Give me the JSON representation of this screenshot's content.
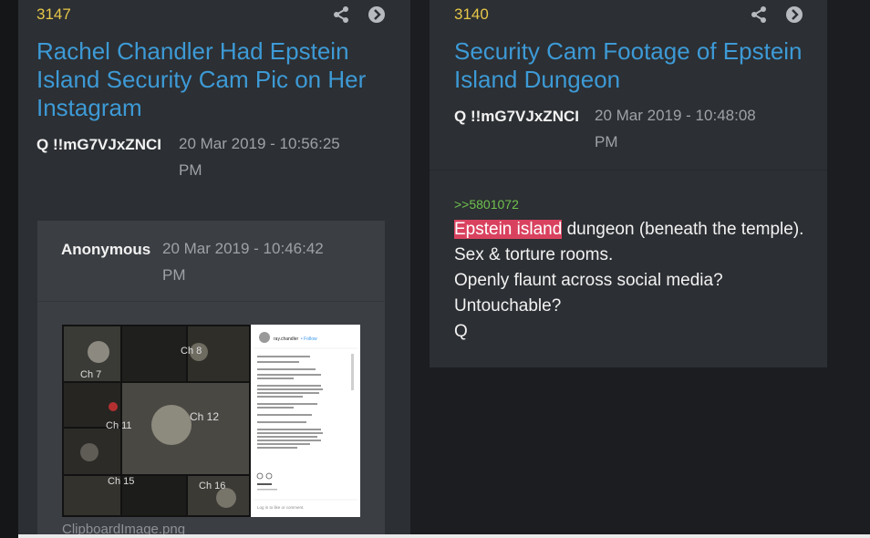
{
  "post_a": {
    "number": "3147",
    "title_lines": [
      "Rachel Chandler Had Epstein",
      "Island Security Cam Pic on Her",
      "Instagram"
    ],
    "author": "Q !!mG7VJxZNCI",
    "timestamp_lines": [
      "20 Mar 2019 - 10:56:25",
      "PM"
    ],
    "quoted": {
      "author": "Anonymous",
      "timestamp_lines": [
        "20 Mar 2019 - 10:46:42",
        "PM"
      ],
      "attachment_name": "ClipboardImage.png"
    }
  },
  "post_b": {
    "number": "3140",
    "title_lines": [
      "Security Cam Footage of Epstein",
      "Island Dungeon"
    ],
    "author": "Q !!mG7VJxZNCI",
    "timestamp_lines": [
      "20 Mar 2019 - 10:48:08",
      "PM"
    ],
    "reply_link": ">>5801072",
    "highlight": "Epstein island",
    "line1_rest": " dungeon (beneath the temple).",
    "lines": [
      "Sex & torture rooms.",
      "Openly flaunt across social media?",
      "Untouchable?",
      "Q"
    ]
  },
  "screenshot": {
    "cam_labels": [
      "Ch 8",
      "Ch 7",
      "Ch 12",
      "Ch 11",
      "Ch 15",
      "Ch 16"
    ],
    "insta_user": "ray.chandler",
    "insta_follow": "• Follow",
    "insta_link": "Log in to like or comment."
  },
  "icons": {
    "share": "share-icon",
    "goto": "arrow-right-circle-icon"
  },
  "colors": {
    "post_number": "#e6c74a",
    "title": "#3d9ad6",
    "reply_link": "#6fc24e",
    "highlight": "#d9425f"
  }
}
